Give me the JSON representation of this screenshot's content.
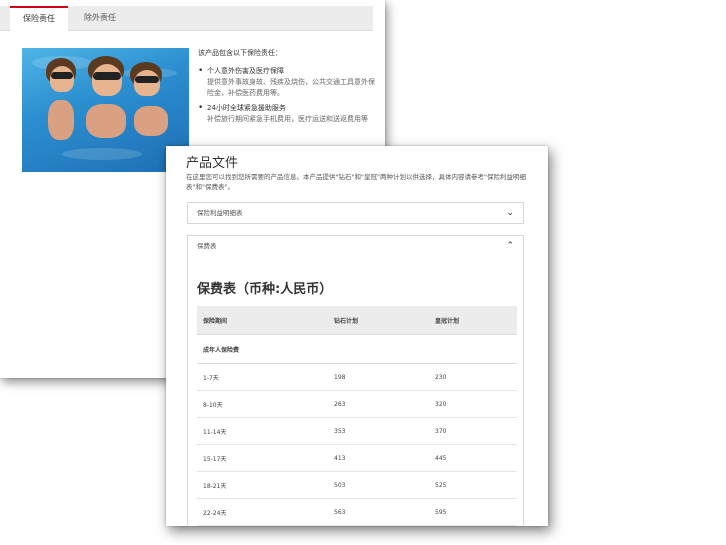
{
  "tabs": [
    {
      "label": "保险责任",
      "active": true
    },
    {
      "label": "除外责任",
      "active": false
    }
  ],
  "coverage": {
    "intro": "该产品包含以下保险责任：",
    "items": [
      {
        "title": "个人意外伤害及医疗保障",
        "desc": "提供意外事故身故、残疾及烧伤，公共交通工具意外保险金，补偿医药费用等。"
      },
      {
        "title": "24小时全球紧急援助服务",
        "desc": "补偿旅行期间紧急手机费用，医疗运送和送返费用等"
      }
    ]
  },
  "product_docs": {
    "title": "产品文件",
    "description": "在这里您可以找到您所需要的产品信息。本产品提供\"钻石\"和\"皇冠\"两种计划以供选择，具体内容请参考\"保险利益明细表\"和\"保费表\"。",
    "accordions": [
      {
        "label": "保险利益明细表",
        "expanded": false,
        "icon": "chevron-down-icon"
      },
      {
        "label": "保费表",
        "expanded": true,
        "icon": "chevron-up-icon"
      }
    ]
  },
  "premium_table": {
    "title": "保费表（币种:人民币）",
    "headers": [
      "保险期间",
      "钻石计划",
      "皇冠计划"
    ],
    "section": "成年人保险费",
    "rows": [
      [
        "1-7天",
        "198",
        "230"
      ],
      [
        "8-10天",
        "263",
        "320"
      ],
      [
        "11-14天",
        "353",
        "370"
      ],
      [
        "15-17天",
        "413",
        "445"
      ],
      [
        "18-21天",
        "503",
        "525"
      ],
      [
        "22-24天",
        "563",
        "595"
      ]
    ]
  },
  "colors": {
    "accent_red": "#d0021b",
    "tab_bg": "#ececec",
    "table_header_bg": "#ececec"
  }
}
